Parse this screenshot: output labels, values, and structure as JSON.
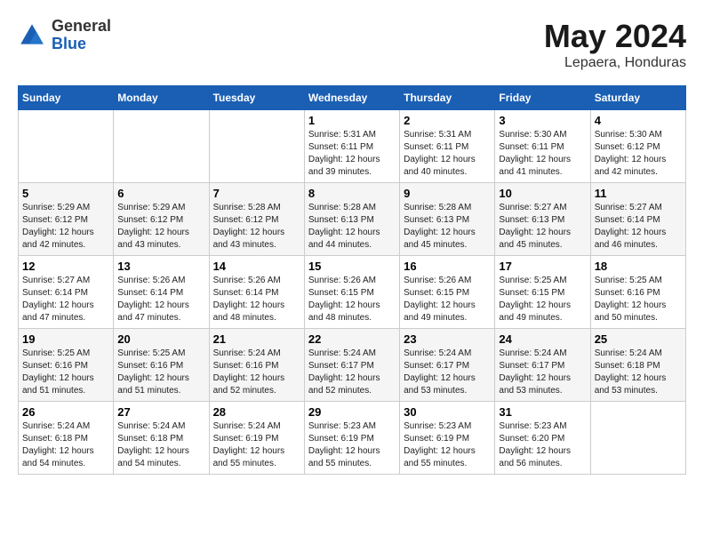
{
  "header": {
    "logo_general": "General",
    "logo_blue": "Blue",
    "month_title": "May 2024",
    "location": "Lepaera, Honduras"
  },
  "days_of_week": [
    "Sunday",
    "Monday",
    "Tuesday",
    "Wednesday",
    "Thursday",
    "Friday",
    "Saturday"
  ],
  "weeks": [
    [
      {
        "day": "",
        "info": ""
      },
      {
        "day": "",
        "info": ""
      },
      {
        "day": "",
        "info": ""
      },
      {
        "day": "1",
        "info": "Sunrise: 5:31 AM\nSunset: 6:11 PM\nDaylight: 12 hours\nand 39 minutes."
      },
      {
        "day": "2",
        "info": "Sunrise: 5:31 AM\nSunset: 6:11 PM\nDaylight: 12 hours\nand 40 minutes."
      },
      {
        "day": "3",
        "info": "Sunrise: 5:30 AM\nSunset: 6:11 PM\nDaylight: 12 hours\nand 41 minutes."
      },
      {
        "day": "4",
        "info": "Sunrise: 5:30 AM\nSunset: 6:12 PM\nDaylight: 12 hours\nand 42 minutes."
      }
    ],
    [
      {
        "day": "5",
        "info": "Sunrise: 5:29 AM\nSunset: 6:12 PM\nDaylight: 12 hours\nand 42 minutes."
      },
      {
        "day": "6",
        "info": "Sunrise: 5:29 AM\nSunset: 6:12 PM\nDaylight: 12 hours\nand 43 minutes."
      },
      {
        "day": "7",
        "info": "Sunrise: 5:28 AM\nSunset: 6:12 PM\nDaylight: 12 hours\nand 43 minutes."
      },
      {
        "day": "8",
        "info": "Sunrise: 5:28 AM\nSunset: 6:13 PM\nDaylight: 12 hours\nand 44 minutes."
      },
      {
        "day": "9",
        "info": "Sunrise: 5:28 AM\nSunset: 6:13 PM\nDaylight: 12 hours\nand 45 minutes."
      },
      {
        "day": "10",
        "info": "Sunrise: 5:27 AM\nSunset: 6:13 PM\nDaylight: 12 hours\nand 45 minutes."
      },
      {
        "day": "11",
        "info": "Sunrise: 5:27 AM\nSunset: 6:14 PM\nDaylight: 12 hours\nand 46 minutes."
      }
    ],
    [
      {
        "day": "12",
        "info": "Sunrise: 5:27 AM\nSunset: 6:14 PM\nDaylight: 12 hours\nand 47 minutes."
      },
      {
        "day": "13",
        "info": "Sunrise: 5:26 AM\nSunset: 6:14 PM\nDaylight: 12 hours\nand 47 minutes."
      },
      {
        "day": "14",
        "info": "Sunrise: 5:26 AM\nSunset: 6:14 PM\nDaylight: 12 hours\nand 48 minutes."
      },
      {
        "day": "15",
        "info": "Sunrise: 5:26 AM\nSunset: 6:15 PM\nDaylight: 12 hours\nand 48 minutes."
      },
      {
        "day": "16",
        "info": "Sunrise: 5:26 AM\nSunset: 6:15 PM\nDaylight: 12 hours\nand 49 minutes."
      },
      {
        "day": "17",
        "info": "Sunrise: 5:25 AM\nSunset: 6:15 PM\nDaylight: 12 hours\nand 49 minutes."
      },
      {
        "day": "18",
        "info": "Sunrise: 5:25 AM\nSunset: 6:16 PM\nDaylight: 12 hours\nand 50 minutes."
      }
    ],
    [
      {
        "day": "19",
        "info": "Sunrise: 5:25 AM\nSunset: 6:16 PM\nDaylight: 12 hours\nand 51 minutes."
      },
      {
        "day": "20",
        "info": "Sunrise: 5:25 AM\nSunset: 6:16 PM\nDaylight: 12 hours\nand 51 minutes."
      },
      {
        "day": "21",
        "info": "Sunrise: 5:24 AM\nSunset: 6:16 PM\nDaylight: 12 hours\nand 52 minutes."
      },
      {
        "day": "22",
        "info": "Sunrise: 5:24 AM\nSunset: 6:17 PM\nDaylight: 12 hours\nand 52 minutes."
      },
      {
        "day": "23",
        "info": "Sunrise: 5:24 AM\nSunset: 6:17 PM\nDaylight: 12 hours\nand 53 minutes."
      },
      {
        "day": "24",
        "info": "Sunrise: 5:24 AM\nSunset: 6:17 PM\nDaylight: 12 hours\nand 53 minutes."
      },
      {
        "day": "25",
        "info": "Sunrise: 5:24 AM\nSunset: 6:18 PM\nDaylight: 12 hours\nand 53 minutes."
      }
    ],
    [
      {
        "day": "26",
        "info": "Sunrise: 5:24 AM\nSunset: 6:18 PM\nDaylight: 12 hours\nand 54 minutes."
      },
      {
        "day": "27",
        "info": "Sunrise: 5:24 AM\nSunset: 6:18 PM\nDaylight: 12 hours\nand 54 minutes."
      },
      {
        "day": "28",
        "info": "Sunrise: 5:24 AM\nSunset: 6:19 PM\nDaylight: 12 hours\nand 55 minutes."
      },
      {
        "day": "29",
        "info": "Sunrise: 5:23 AM\nSunset: 6:19 PM\nDaylight: 12 hours\nand 55 minutes."
      },
      {
        "day": "30",
        "info": "Sunrise: 5:23 AM\nSunset: 6:19 PM\nDaylight: 12 hours\nand 55 minutes."
      },
      {
        "day": "31",
        "info": "Sunrise: 5:23 AM\nSunset: 6:20 PM\nDaylight: 12 hours\nand 56 minutes."
      },
      {
        "day": "",
        "info": ""
      }
    ]
  ]
}
